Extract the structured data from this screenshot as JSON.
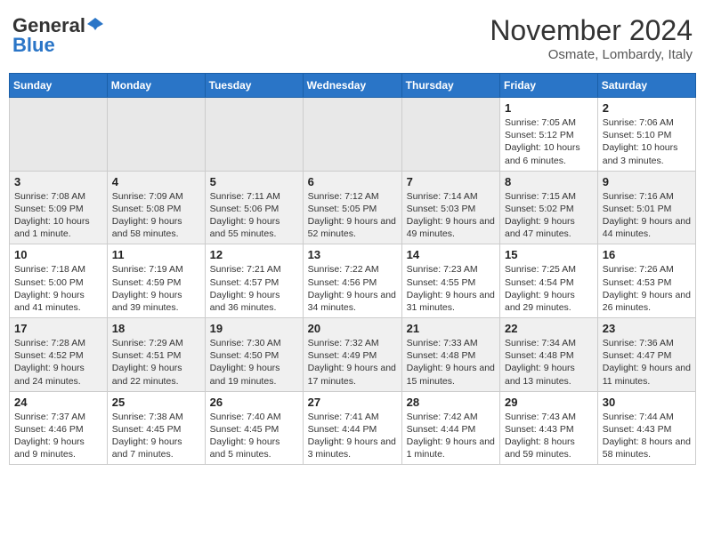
{
  "header": {
    "logo_line1": "General",
    "logo_line2": "Blue",
    "month": "November 2024",
    "location": "Osmate, Lombardy, Italy"
  },
  "days_of_week": [
    "Sunday",
    "Monday",
    "Tuesday",
    "Wednesday",
    "Thursday",
    "Friday",
    "Saturday"
  ],
  "weeks": [
    [
      {
        "day": "",
        "info": ""
      },
      {
        "day": "",
        "info": ""
      },
      {
        "day": "",
        "info": ""
      },
      {
        "day": "",
        "info": ""
      },
      {
        "day": "",
        "info": ""
      },
      {
        "day": "1",
        "info": "Sunrise: 7:05 AM\nSunset: 5:12 PM\nDaylight: 10 hours and 6 minutes."
      },
      {
        "day": "2",
        "info": "Sunrise: 7:06 AM\nSunset: 5:10 PM\nDaylight: 10 hours and 3 minutes."
      }
    ],
    [
      {
        "day": "3",
        "info": "Sunrise: 7:08 AM\nSunset: 5:09 PM\nDaylight: 10 hours and 1 minute."
      },
      {
        "day": "4",
        "info": "Sunrise: 7:09 AM\nSunset: 5:08 PM\nDaylight: 9 hours and 58 minutes."
      },
      {
        "day": "5",
        "info": "Sunrise: 7:11 AM\nSunset: 5:06 PM\nDaylight: 9 hours and 55 minutes."
      },
      {
        "day": "6",
        "info": "Sunrise: 7:12 AM\nSunset: 5:05 PM\nDaylight: 9 hours and 52 minutes."
      },
      {
        "day": "7",
        "info": "Sunrise: 7:14 AM\nSunset: 5:03 PM\nDaylight: 9 hours and 49 minutes."
      },
      {
        "day": "8",
        "info": "Sunrise: 7:15 AM\nSunset: 5:02 PM\nDaylight: 9 hours and 47 minutes."
      },
      {
        "day": "9",
        "info": "Sunrise: 7:16 AM\nSunset: 5:01 PM\nDaylight: 9 hours and 44 minutes."
      }
    ],
    [
      {
        "day": "10",
        "info": "Sunrise: 7:18 AM\nSunset: 5:00 PM\nDaylight: 9 hours and 41 minutes."
      },
      {
        "day": "11",
        "info": "Sunrise: 7:19 AM\nSunset: 4:59 PM\nDaylight: 9 hours and 39 minutes."
      },
      {
        "day": "12",
        "info": "Sunrise: 7:21 AM\nSunset: 4:57 PM\nDaylight: 9 hours and 36 minutes."
      },
      {
        "day": "13",
        "info": "Sunrise: 7:22 AM\nSunset: 4:56 PM\nDaylight: 9 hours and 34 minutes."
      },
      {
        "day": "14",
        "info": "Sunrise: 7:23 AM\nSunset: 4:55 PM\nDaylight: 9 hours and 31 minutes."
      },
      {
        "day": "15",
        "info": "Sunrise: 7:25 AM\nSunset: 4:54 PM\nDaylight: 9 hours and 29 minutes."
      },
      {
        "day": "16",
        "info": "Sunrise: 7:26 AM\nSunset: 4:53 PM\nDaylight: 9 hours and 26 minutes."
      }
    ],
    [
      {
        "day": "17",
        "info": "Sunrise: 7:28 AM\nSunset: 4:52 PM\nDaylight: 9 hours and 24 minutes."
      },
      {
        "day": "18",
        "info": "Sunrise: 7:29 AM\nSunset: 4:51 PM\nDaylight: 9 hours and 22 minutes."
      },
      {
        "day": "19",
        "info": "Sunrise: 7:30 AM\nSunset: 4:50 PM\nDaylight: 9 hours and 19 minutes."
      },
      {
        "day": "20",
        "info": "Sunrise: 7:32 AM\nSunset: 4:49 PM\nDaylight: 9 hours and 17 minutes."
      },
      {
        "day": "21",
        "info": "Sunrise: 7:33 AM\nSunset: 4:48 PM\nDaylight: 9 hours and 15 minutes."
      },
      {
        "day": "22",
        "info": "Sunrise: 7:34 AM\nSunset: 4:48 PM\nDaylight: 9 hours and 13 minutes."
      },
      {
        "day": "23",
        "info": "Sunrise: 7:36 AM\nSunset: 4:47 PM\nDaylight: 9 hours and 11 minutes."
      }
    ],
    [
      {
        "day": "24",
        "info": "Sunrise: 7:37 AM\nSunset: 4:46 PM\nDaylight: 9 hours and 9 minutes."
      },
      {
        "day": "25",
        "info": "Sunrise: 7:38 AM\nSunset: 4:45 PM\nDaylight: 9 hours and 7 minutes."
      },
      {
        "day": "26",
        "info": "Sunrise: 7:40 AM\nSunset: 4:45 PM\nDaylight: 9 hours and 5 minutes."
      },
      {
        "day": "27",
        "info": "Sunrise: 7:41 AM\nSunset: 4:44 PM\nDaylight: 9 hours and 3 minutes."
      },
      {
        "day": "28",
        "info": "Sunrise: 7:42 AM\nSunset: 4:44 PM\nDaylight: 9 hours and 1 minute."
      },
      {
        "day": "29",
        "info": "Sunrise: 7:43 AM\nSunset: 4:43 PM\nDaylight: 8 hours and 59 minutes."
      },
      {
        "day": "30",
        "info": "Sunrise: 7:44 AM\nSunset: 4:43 PM\nDaylight: 8 hours and 58 minutes."
      }
    ]
  ]
}
